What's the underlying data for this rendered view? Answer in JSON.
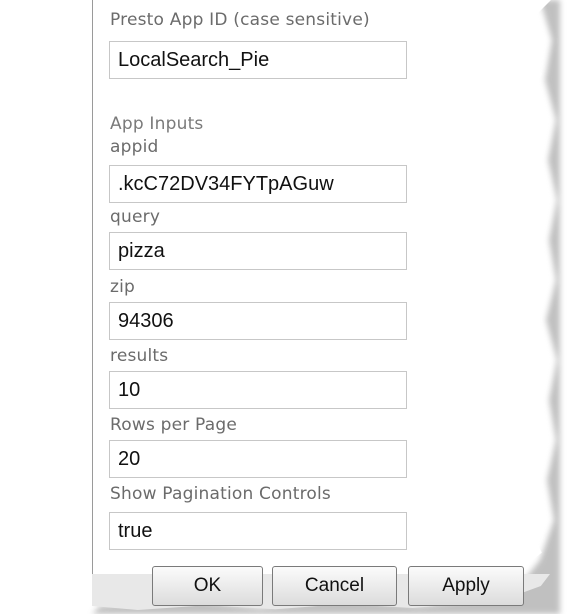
{
  "app_id": {
    "label": "Presto App ID (case sensitive)",
    "value": "LocalSearch_Pie"
  },
  "app_inputs": {
    "section_label": "App Inputs",
    "fields": [
      {
        "label": "appid",
        "value": ".kcC72DV34FYTpAGuw"
      },
      {
        "label": "query",
        "value": "pizza"
      },
      {
        "label": "zip",
        "value": "94306"
      },
      {
        "label": "results",
        "value": "10"
      },
      {
        "label": "Rows per Page",
        "value": "20"
      },
      {
        "label": "Show Pagination Controls",
        "value": "true"
      }
    ]
  },
  "buttons": {
    "ok": "OK",
    "cancel": "Cancel",
    "apply": "Apply"
  },
  "colors": {
    "label_text": "#6b6b6b",
    "field_border": "#c7c7c7",
    "value_text": "#111111",
    "button_border": "#7a7a7a"
  }
}
